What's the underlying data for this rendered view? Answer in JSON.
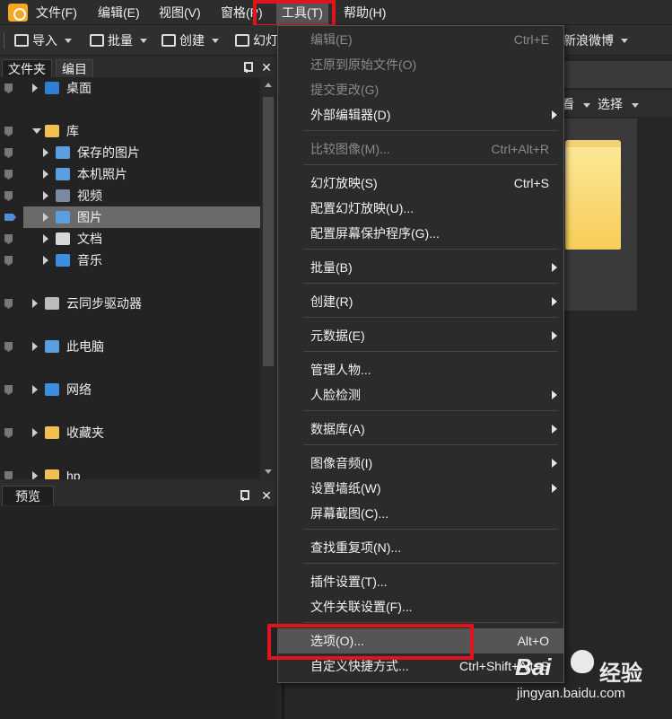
{
  "menubar": {
    "items": [
      "文件(F)",
      "编辑(E)",
      "视图(V)",
      "窗格(P)",
      "工具(T)",
      "帮助(H)"
    ]
  },
  "toolbar": {
    "import": "导入",
    "batch": "批量",
    "create": "创建",
    "slideshow": "幻灯",
    "weibo": "新浪微博"
  },
  "folder_panel": {
    "tab_folders": "文件夹",
    "tab_catalog": "编目",
    "tree": [
      {
        "label": "桌面",
        "level": 0,
        "icon": "desktop-icon",
        "expanded": false
      },
      {
        "label": "库",
        "level": 0,
        "icon": "library-icon",
        "expanded": true
      },
      {
        "label": "保存的图片",
        "level": 1,
        "icon": "picture-icon",
        "expanded": false
      },
      {
        "label": "本机照片",
        "level": 1,
        "icon": "picture-icon",
        "expanded": false
      },
      {
        "label": "视频",
        "level": 1,
        "icon": "video-icon",
        "expanded": false
      },
      {
        "label": "图片",
        "level": 1,
        "icon": "picture-icon",
        "expanded": false,
        "selected": true
      },
      {
        "label": "文档",
        "level": 1,
        "icon": "document-icon",
        "expanded": false
      },
      {
        "label": "音乐",
        "level": 1,
        "icon": "music-icon",
        "expanded": false
      },
      {
        "label": "云同步驱动器",
        "level": 0,
        "icon": "cloud-icon",
        "expanded": false
      },
      {
        "label": "此电脑",
        "level": 0,
        "icon": "computer-icon",
        "expanded": false
      },
      {
        "label": "网络",
        "level": 0,
        "icon": "network-icon",
        "expanded": false
      },
      {
        "label": "收藏夹",
        "level": 0,
        "icon": "favorites-icon",
        "expanded": false
      },
      {
        "label": "hp",
        "level": 0,
        "icon": "folder-icon",
        "expanded": false
      }
    ]
  },
  "preview_panel": {
    "tab": "预览"
  },
  "right_area": {
    "view_label": "看",
    "select_label": "选择"
  },
  "tools_menu": {
    "items": [
      {
        "label": "编辑(E)",
        "shortcut": "Ctrl+E",
        "disabled": true
      },
      {
        "label": "还原到原始文件(O)",
        "shortcut": "",
        "disabled": true
      },
      {
        "label": "提交更改(G)",
        "shortcut": "",
        "disabled": true
      },
      {
        "label": "外部编辑器(D)",
        "shortcut": "",
        "submenu": true
      },
      {
        "label": "比较图像(M)...",
        "shortcut": "Ctrl+Alt+R",
        "disabled": true
      },
      {
        "label": "幻灯放映(S)",
        "shortcut": "Ctrl+S"
      },
      {
        "label": "配置幻灯放映(U)...",
        "shortcut": ""
      },
      {
        "label": "配置屏幕保护程序(G)...",
        "shortcut": ""
      },
      {
        "label": "批量(B)",
        "shortcut": "",
        "submenu": true
      },
      {
        "label": "创建(R)",
        "shortcut": "",
        "submenu": true
      },
      {
        "label": "元数据(E)",
        "shortcut": "",
        "submenu": true
      },
      {
        "label": "管理人物...",
        "shortcut": ""
      },
      {
        "label": "人脸检测",
        "shortcut": "",
        "submenu": true
      },
      {
        "label": "数据库(A)",
        "shortcut": "",
        "submenu": true
      },
      {
        "label": "图像音频(I)",
        "shortcut": "",
        "submenu": true
      },
      {
        "label": "设置墙纸(W)",
        "shortcut": "",
        "submenu": true
      },
      {
        "label": "屏幕截图(C)...",
        "shortcut": ""
      },
      {
        "label": "查找重复项(N)...",
        "shortcut": ""
      },
      {
        "label": "插件设置(T)...",
        "shortcut": ""
      },
      {
        "label": "文件关联设置(F)...",
        "shortcut": ""
      },
      {
        "label": "选项(O)...",
        "shortcut": "Alt+O",
        "highlighted": true
      },
      {
        "label": "自定义快捷方式...",
        "shortcut": "Ctrl+Shift+Alt+S"
      }
    ]
  },
  "watermark": {
    "brand": "Bai",
    "brand_suffix": "经验",
    "url": "jingyan.baidu.com"
  },
  "colors": {
    "highlight_box": "#e0141e",
    "selection": "#6a6a6a",
    "menu_background": "#2b2b2b"
  }
}
